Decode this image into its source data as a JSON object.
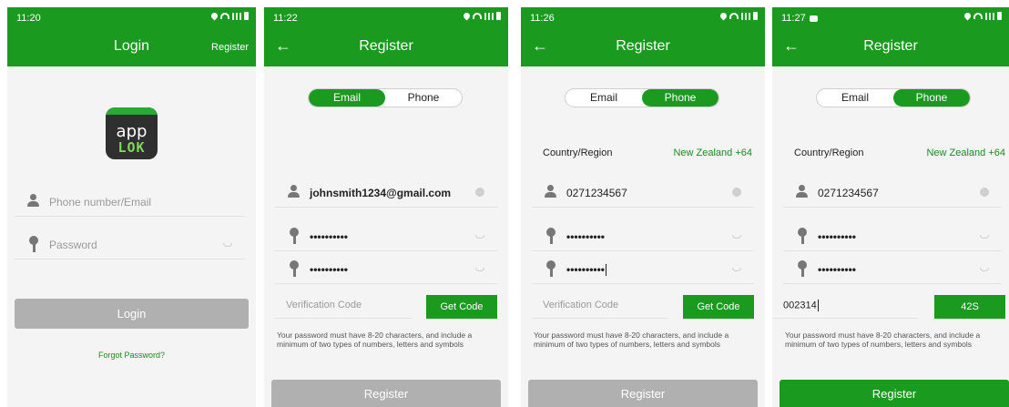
{
  "screens": [
    {
      "status": {
        "time": "11:20"
      },
      "title": "Login",
      "register_link": "Register",
      "logo": {
        "line1": "app",
        "line2": "LOK"
      },
      "identifier": {
        "placeholder": "Phone number/Email",
        "icon": "user-icon"
      },
      "password": {
        "placeholder": "Password",
        "icon": "key-icon"
      },
      "login_button": "Login",
      "forgot_link": "Forgot Password?"
    },
    {
      "status": {
        "time": "11:22"
      },
      "title": "Register",
      "tabs": [
        "Email",
        "Phone"
      ],
      "active_tab": "Email",
      "email_value": "johnsmith1234@gmail.com",
      "password_value": "••••••••••",
      "confirm_value": "••••••••••",
      "verification_placeholder": "Verification Code",
      "get_code": "Get Code",
      "hint": "Your password must have 8-20 characters, and include a minimum of two types of numbers, letters and symbols",
      "register_button": "Register"
    },
    {
      "status": {
        "time": "11:26"
      },
      "title": "Register",
      "tabs": [
        "Email",
        "Phone"
      ],
      "active_tab": "Phone",
      "region_label": "Country/Region",
      "region_value": "New Zealand +64",
      "phone_value": "0271234567",
      "password_value": "••••••••••",
      "confirm_value": "••••••••••",
      "verification_placeholder": "Verification Code",
      "get_code": "Get Code",
      "hint": "Your password must have 8-20 characters, and include a minimum of two types of numbers, letters and symbols",
      "register_button": "Register"
    },
    {
      "status": {
        "time": "11:27"
      },
      "title": "Register",
      "tabs": [
        "Email",
        "Phone"
      ],
      "active_tab": "Phone",
      "region_label": "Country/Region",
      "region_value": "New Zealand +64",
      "phone_value": "0271234567",
      "password_value": "••••••••••",
      "confirm_value": "••••••••••",
      "verification_value": "002314",
      "countdown": "42S",
      "hint": "Your password must have 8-20 characters, and include a minimum of two types of numbers, letters and symbols",
      "register_button": "Register"
    }
  ],
  "colors": {
    "brand": "#1a9a1f",
    "disabled": "#b0b0b0"
  }
}
